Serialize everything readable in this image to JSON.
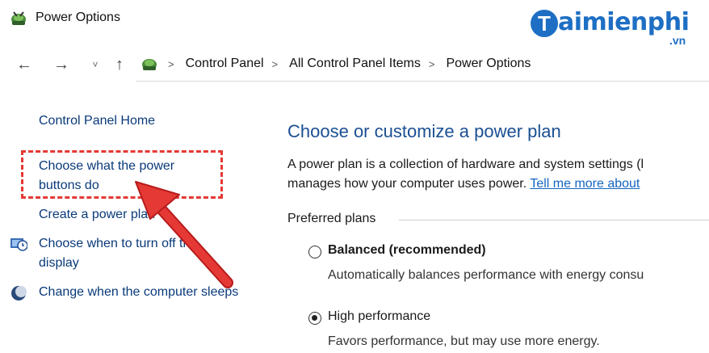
{
  "window": {
    "title": "Power Options",
    "icon": "power-options-icon"
  },
  "watermark": {
    "logo_letter": "T",
    "logo_text": "aimienphi",
    "logo_suffix": ".vn",
    "brand_color": "#1e6fc4"
  },
  "nav": {
    "back": "←",
    "forward": "→",
    "recent": "˅",
    "up": "↑",
    "breadcrumbs": [
      "Control Panel",
      "All Control Panel Items",
      "Power Options"
    ]
  },
  "sidebar": {
    "home": "Control Panel Home",
    "power_buttons": "Choose what the power buttons do",
    "create_plan": "Create a power plan",
    "turn_off_display": "Choose when to turn off the display",
    "sleep": "Change when the computer sleeps"
  },
  "main": {
    "title": "Choose or customize a power plan",
    "desc_line1": "A power plan is a collection of hardware and system settings (l",
    "desc_line2": "manages how your computer uses power.",
    "desc_link": "Tell me more about",
    "group_label": "Preferred plans",
    "plans": [
      {
        "name": "Balanced (recommended)",
        "description": "Automatically balances performance with energy consu",
        "selected": false
      },
      {
        "name": "High performance",
        "description": "Favors performance, but may use more energy.",
        "selected": true
      }
    ]
  },
  "annotation": {
    "highlight_color": "#e53935"
  }
}
